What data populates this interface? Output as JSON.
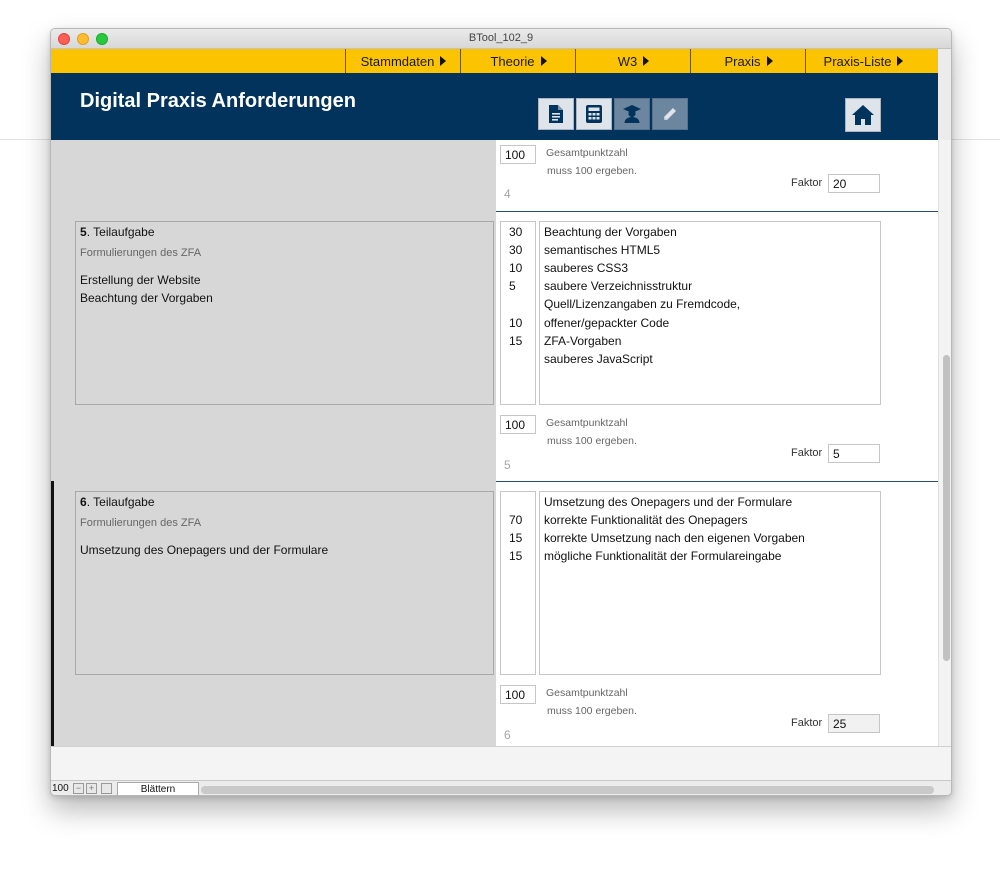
{
  "window": {
    "title": "BTool_102_9"
  },
  "nav": {
    "items": [
      "Stammdaten",
      "Theorie",
      "W3",
      "Praxis",
      "Praxis-Liste"
    ]
  },
  "header": {
    "title": "Digital Praxis Anforderungen",
    "buttons": [
      "document-icon",
      "calculator-icon",
      "graduate-icon",
      "pencil-icon"
    ],
    "home_icon": "home-icon"
  },
  "sections": [
    {
      "number": "4",
      "total": "100",
      "total_label": "Gesamtpunktzahl",
      "total_note": "muss 100 ergeben.",
      "faktor_label": "Faktor",
      "faktor": "20"
    },
    {
      "number": "5",
      "task_suffix": ". Teilaufgabe",
      "subtitle": "Formulierungen des ZFA",
      "text": [
        "Erstellung der Website",
        "Beachtung der Vorgaben"
      ],
      "points": [
        "30",
        "30",
        "10",
        "5",
        "",
        "10",
        "15",
        ""
      ],
      "criteria": [
        "Beachtung der Vorgaben",
        "semantisches HTML5",
        "sauberes CSS3",
        "saubere Verzeichnisstruktur",
        "Quell/Lizenzangaben zu Fremdcode,",
        "offener/gepackter Code",
        "ZFA-Vorgaben",
        "sauberes JavaScript"
      ],
      "total": "100",
      "total_label": "Gesamtpunktzahl",
      "total_note": "muss 100 ergeben.",
      "faktor_label": "Faktor",
      "faktor": "5"
    },
    {
      "number": "6",
      "task_suffix": ". Teilaufgabe",
      "subtitle": "Formulierungen des ZFA",
      "text": [
        "Umsetzung des Onepagers und der Formulare"
      ],
      "points": [
        "",
        "70",
        "15",
        "15"
      ],
      "criteria": [
        "Umsetzung des Onepagers und der Formulare",
        "korrekte Funktionalität des Onepagers",
        "korrekte Umsetzung nach den eigenen Vorgaben",
        "mögliche Funktionalität der Formulareingabe"
      ],
      "total": "100",
      "total_label": "Gesamtpunktzahl",
      "total_note": "muss 100 ergeben.",
      "faktor_label": "Faktor",
      "faktor": "25"
    }
  ],
  "status": {
    "zoom": "100",
    "mode": "Blättern"
  }
}
